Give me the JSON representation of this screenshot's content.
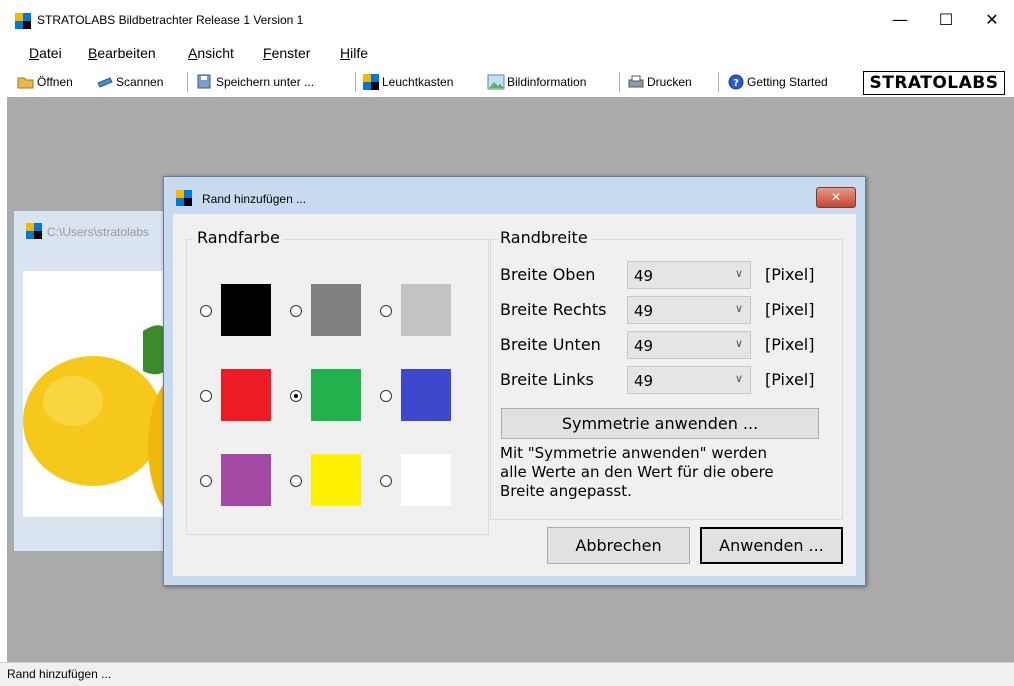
{
  "window": {
    "title": "STRATOLABS Bildbetrachter Release 1 Version 1",
    "controls": {
      "minimize": "—",
      "maximize": "☐",
      "close": "✕"
    }
  },
  "menu": [
    {
      "label": "Datei"
    },
    {
      "label": "Bearbeiten"
    },
    {
      "label": "Ansicht"
    },
    {
      "label": "Fenster"
    },
    {
      "label": "Hilfe"
    }
  ],
  "toolbar": {
    "open": "Öffnen",
    "scan": "Scannen",
    "save_as": "Speichern unter ...",
    "lightbox": "Leuchtkasten",
    "image_info": "Bildinformation",
    "print": "Drucken",
    "getting_started": "Getting Started",
    "brand": "STRATOLABS"
  },
  "child_window": {
    "title": "C:\\Users\\stratolabs"
  },
  "dialog": {
    "title": "Rand hinzufügen ...",
    "close": "✕",
    "border_color_group": "Randfarbe",
    "colors": [
      {
        "hex": "#000000",
        "selected": false
      },
      {
        "hex": "#7f7f7f",
        "selected": false
      },
      {
        "hex": "#c3c3c3",
        "selected": false
      },
      {
        "hex": "#ed1c24",
        "selected": false
      },
      {
        "hex": "#22b14c",
        "selected": true
      },
      {
        "hex": "#3f48cc",
        "selected": false
      },
      {
        "hex": "#a349a4",
        "selected": false
      },
      {
        "hex": "#fff200",
        "selected": false
      },
      {
        "hex": "#ffffff",
        "selected": false
      }
    ],
    "border_width_group": "Randbreite",
    "rows": [
      {
        "label": "Breite Oben",
        "value": "49",
        "unit": "[Pixel]"
      },
      {
        "label": "Breite Rechts",
        "value": "49",
        "unit": "[Pixel]"
      },
      {
        "label": "Breite Unten",
        "value": "49",
        "unit": "[Pixel]"
      },
      {
        "label": "Breite Links",
        "value": "49",
        "unit": "[Pixel]"
      }
    ],
    "symmetry_button": "Symmetrie anwenden ...",
    "help_text": [
      "Mit \"Symmetrie anwenden\" werden",
      "alle Werte an den Wert für die obere",
      "Breite angepasst."
    ],
    "cancel_button": "Abbrechen",
    "apply_button": "Anwenden ..."
  },
  "status": {
    "text": "Rand hinzufügen ..."
  }
}
